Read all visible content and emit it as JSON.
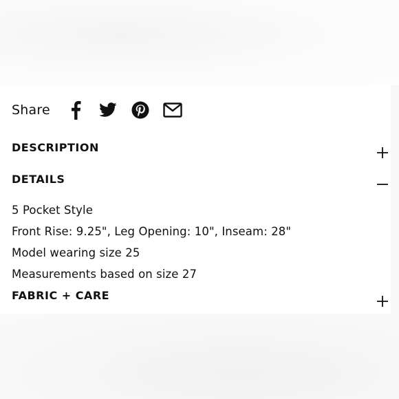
{
  "share": {
    "label": "Share",
    "icons": [
      "facebook-icon",
      "twitter-icon",
      "pinterest-icon",
      "email-icon"
    ]
  },
  "accordion": {
    "description": {
      "title": "DESCRIPTION",
      "expanded": false
    },
    "details": {
      "title": "DETAILS",
      "expanded": true,
      "items": [
        "5 Pocket Style",
        "Front Rise: 9.25\", Leg Opening: 10\", Inseam: 28\"",
        "Model wearing size 25",
        "Measurements based on size 27"
      ]
    },
    "fabric_care": {
      "title": "FABRIC + CARE",
      "expanded": false
    }
  },
  "colors": {
    "text": "#111111",
    "panel": "#ffffff",
    "background": "#f8f8f8"
  }
}
